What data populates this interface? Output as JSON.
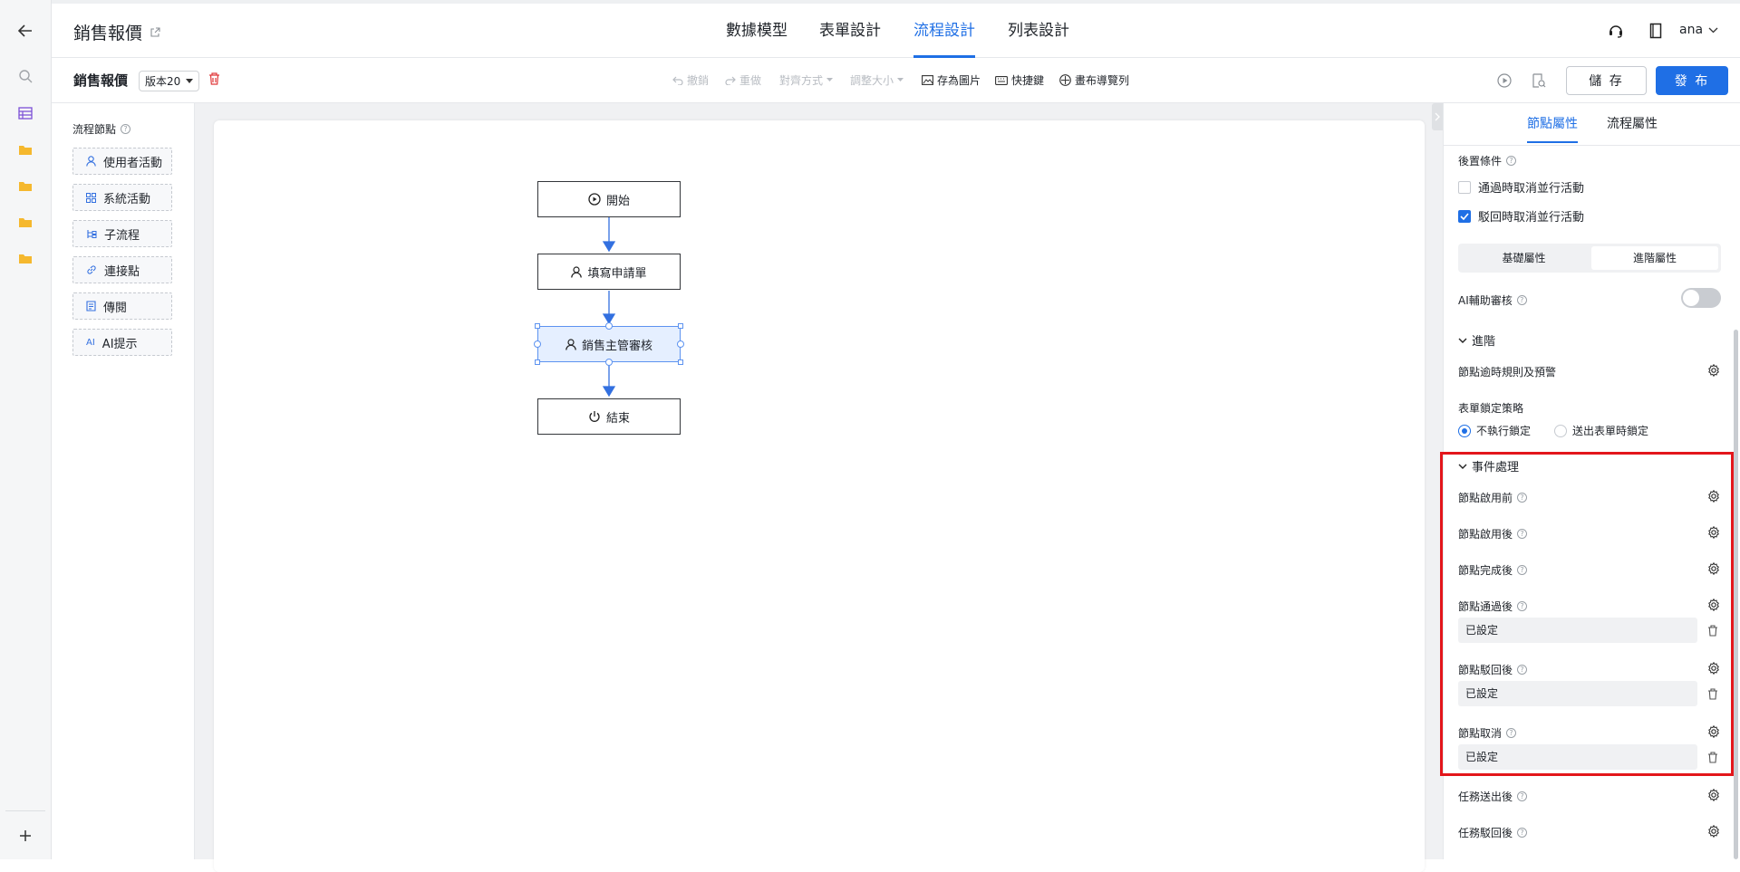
{
  "header": {
    "app_title": "銷售報價",
    "nav_tabs": [
      {
        "label": "數據模型",
        "active": false
      },
      {
        "label": "表單設計",
        "active": false
      },
      {
        "label": "流程設計",
        "active": true
      },
      {
        "label": "列表設計",
        "active": false
      }
    ],
    "user_name": "ana"
  },
  "toolbar": {
    "doc_title": "銷售報價",
    "version_label": "版本20",
    "undo_label": "撤銷",
    "redo_label": "重做",
    "align_label": "對齊方式",
    "resize_label": "調整大小",
    "save_image_label": "存為圖片",
    "shortcut_label": "快捷鍵",
    "navigator_label": "畫布導覽列",
    "save_button": "儲 存",
    "publish_button": "發 布"
  },
  "palette": {
    "title": "流程節點",
    "items": [
      {
        "label": "使用者活動",
        "icon": "user-icon"
      },
      {
        "label": "系統活動",
        "icon": "grid-icon"
      },
      {
        "label": "子流程",
        "icon": "subprocess-icon"
      },
      {
        "label": "連接點",
        "icon": "link-icon"
      },
      {
        "label": "傳閱",
        "icon": "document-icon"
      },
      {
        "label": "AI提示",
        "icon": "ai-icon"
      }
    ]
  },
  "flow": {
    "nodes": [
      {
        "label": "開始",
        "icon": "play-icon"
      },
      {
        "label": "填寫申請單",
        "icon": "user-icon"
      },
      {
        "label": "銷售主管審核",
        "icon": "user-icon",
        "selected": true
      },
      {
        "label": "結束",
        "icon": "power-icon"
      }
    ]
  },
  "panel": {
    "tabs": [
      {
        "label": "節點屬性",
        "active": true
      },
      {
        "label": "流程屬性",
        "active": false
      }
    ],
    "post_condition_title": "後置條件",
    "checkbox_pass": {
      "label": "通過時取消並行活動",
      "checked": false
    },
    "checkbox_reject": {
      "label": "駁回時取消並行活動",
      "checked": true
    },
    "seg_basic": "基礎屬性",
    "seg_advanced": "進階屬性",
    "ai_review_label": "AI輔助審核",
    "ai_review_on": false,
    "advanced_section": "進階",
    "timeout_label": "節點逾時規則及預警",
    "form_lock_label": "表單鎖定策略",
    "lock_option_none": "不執行鎖定",
    "lock_option_submit": "送出表單時鎖定",
    "event_section": "事件處理",
    "events": {
      "before_start": "節點啟用前",
      "after_start": "節點啟用後",
      "after_complete": "節點完成後",
      "after_pass": "節點通過後",
      "after_pass_value": "已設定",
      "after_reject": "節點駁回後",
      "after_reject_value": "已設定",
      "cancel": "節點取消",
      "cancel_value": "已設定",
      "task_submitted": "任務送出後",
      "task_rejected": "任務駁回後"
    }
  },
  "colors": {
    "accent": "#1f6fe5",
    "highlight": "#e3161b"
  }
}
